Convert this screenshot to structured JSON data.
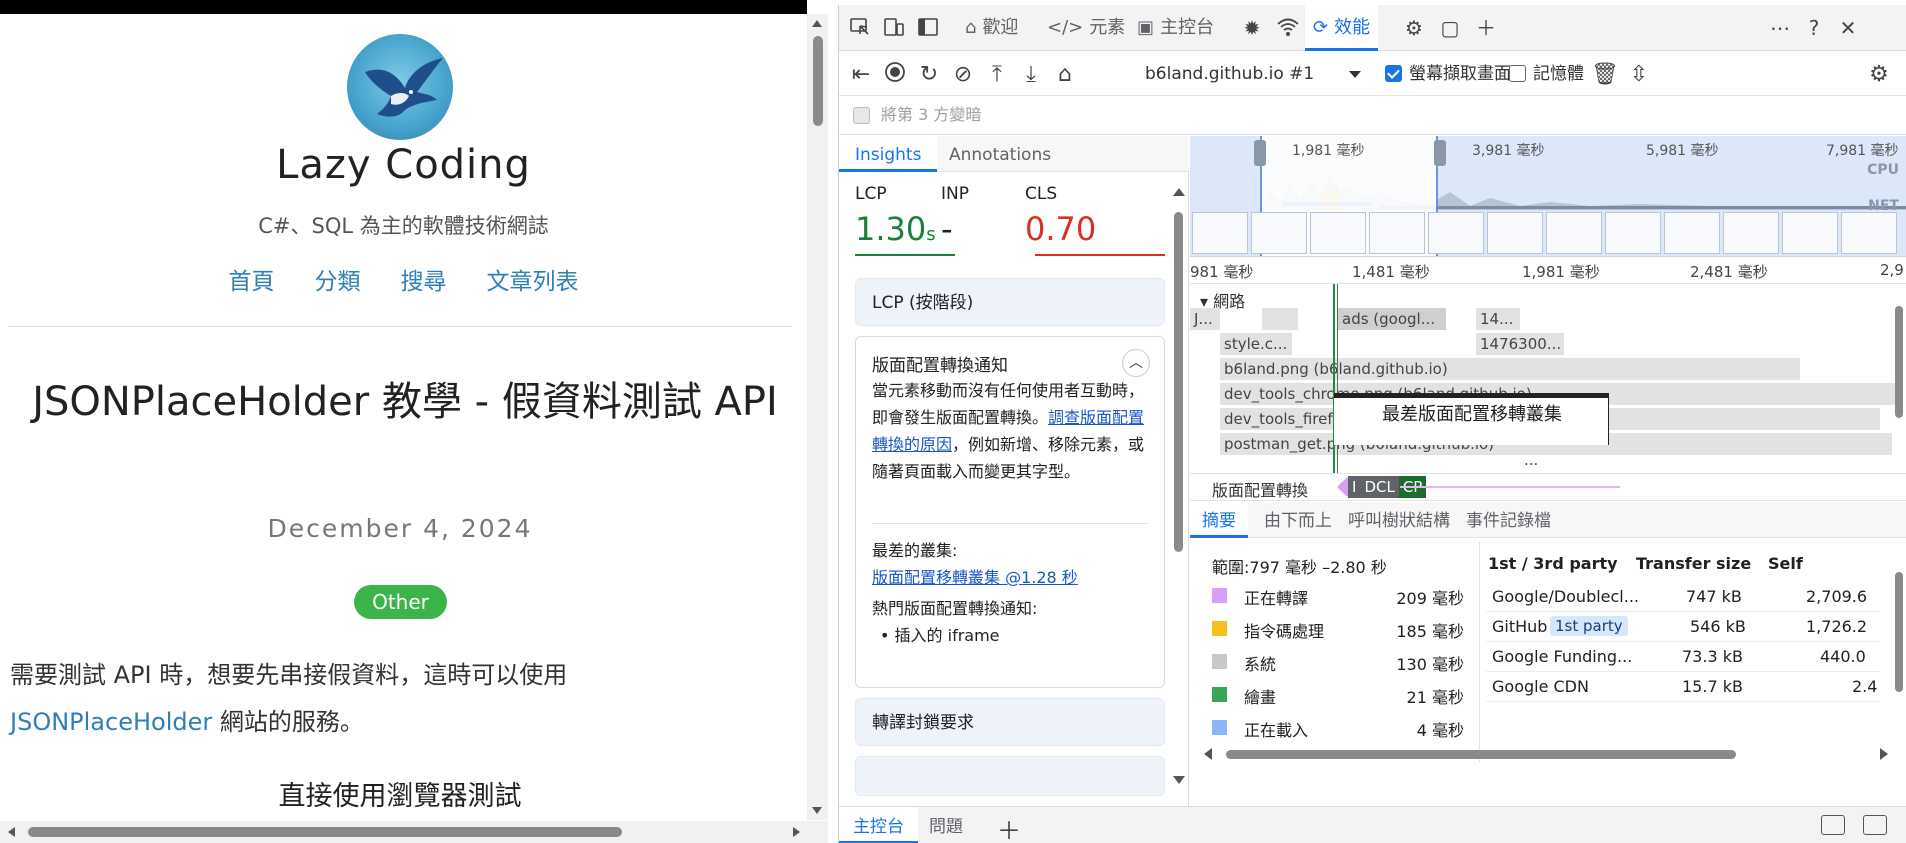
{
  "page": {
    "site_title": "Lazy Coding",
    "site_subtitle": "C#、SQL 為主的軟體技術網誌",
    "nav": [
      "首頁",
      "分類",
      "搜尋",
      "文章列表"
    ],
    "post_title": "JSONPlaceHolder 教學 - 假資料測試 API",
    "post_date": "December 4, 2024",
    "post_tag": "Other",
    "post_body_1": "需要測試 API 時，想要先串接假資料，這時可以使用 ",
    "post_body_link": "JSONPlaceHolder",
    "post_body_2": " 網站的服務。",
    "section_heading": "直接使用瀏覽器測試"
  },
  "devtools": {
    "tabs": {
      "welcome": "歡迎",
      "elements": "元素",
      "console": "主控台",
      "performance": "效能"
    },
    "toolbar": {
      "profile": "b6land.github.io #1",
      "screenshots_label": "螢幕擷取畫面",
      "screenshots_checked": true,
      "memory_label": "記憶體",
      "memory_checked": false,
      "dim_third_party": "將第 3 方變暗"
    },
    "sidebar": {
      "tab_insights": "Insights",
      "tab_annotations": "Annotations",
      "lcp_label": "LCP",
      "lcp_value": "1.30",
      "lcp_unit": "s",
      "inp_label": "INP",
      "inp_value": "-",
      "cls_label": "CLS",
      "cls_value": "0.70",
      "card_lcp_phases": "LCP (按階段)",
      "card_layout_title": "版面配置轉換通知",
      "card_layout_text_1": "當元素移動而沒有任何使用者互動時，即會發生版面配置轉換。",
      "card_layout_link": "調查版面配置轉換的原因",
      "card_layout_text_2": "，例如新增、移除元素，或隨著頁面載入而變更其字型。",
      "worst_cluster_label": "最差的叢集:",
      "worst_cluster_link": "版面配置移轉叢集 @1.28 秒",
      "hot_shift_label": "熱門版面配置轉換通知:",
      "hot_shift_item": "插入的 iframe",
      "card_render_blocking": "轉譯封鎖要求"
    },
    "overview": {
      "ticks": [
        "1,981 毫秒",
        "3,981 毫秒",
        "5,981 毫秒",
        "7,981 毫秒"
      ],
      "cpu": "CPU",
      "net": "NET"
    },
    "track": {
      "ruler": [
        "981 毫秒",
        "1,481 毫秒",
        "1,981 毫秒",
        "2,481 毫秒",
        "2,9"
      ],
      "network_label": "網路",
      "requests": [
        "J...",
        "ads (googl...",
        "14...",
        "style.c...",
        "1476300...",
        "b6land.png (b6land.github.io)",
        "dev_tools_chrome.png (b6land.github.io)",
        "dev_tools_firefox.png (b6land.github.io)",
        "postman_get.png (b6land.github.io)",
        "..."
      ],
      "tooltip": "最差版面配置移轉叢集",
      "layout_shift_label": "版面配置轉換",
      "markers": [
        "I",
        "DCL",
        "CP"
      ]
    },
    "bottom": {
      "tabs": [
        "摘要",
        "由下而上",
        "呼叫樹狀結構",
        "事件記錄檔"
      ],
      "range": "範圍:797 毫秒 –2.80 秒",
      "summary": [
        {
          "name": "正在轉譯",
          "value": "209 毫秒",
          "color": "#d7a0f7"
        },
        {
          "name": "指令碼處理",
          "value": "185 毫秒",
          "color": "#f2c21e"
        },
        {
          "name": "系統",
          "value": "130 毫秒",
          "color": "#c8c8c8"
        },
        {
          "name": "繪畫",
          "value": "21 毫秒",
          "color": "#34a853"
        },
        {
          "name": "正在載入",
          "value": "4 毫秒",
          "color": "#8ab4f8"
        }
      ],
      "third_party_headers": [
        "1st / 3rd party",
        "Transfer size",
        "Self"
      ],
      "third_party_rows": [
        {
          "name": "Google/Doublecl...",
          "badge": "",
          "size": "747 kB",
          "self": "2,709.6"
        },
        {
          "name": "GitHub",
          "badge": "1st party",
          "size": "546 kB",
          "self": "1,726.2"
        },
        {
          "name": "Google Funding...",
          "badge": "",
          "size": "73.3 kB",
          "self": "440.0"
        },
        {
          "name": "Google CDN",
          "badge": "",
          "size": "15.7 kB",
          "self": "2.4"
        }
      ]
    },
    "drawer": {
      "console": "主控台",
      "issues": "問題"
    }
  }
}
